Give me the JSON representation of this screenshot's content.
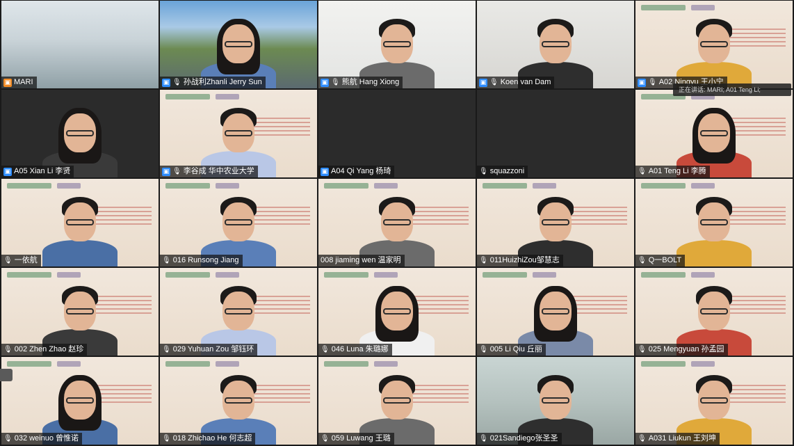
{
  "tiles": [
    {
      "name": "MARI",
      "mic": "none",
      "badge": "orange",
      "bg": "room",
      "person": false
    },
    {
      "name": "孙战利Zhanli Jerry Sun",
      "mic": "mic",
      "badge": "blue",
      "bg": "outdoor",
      "person": true,
      "long_hair": true
    },
    {
      "name": "熊航 Hang Xiong",
      "mic": "mic",
      "badge": "blue",
      "bg": "white",
      "person": true
    },
    {
      "name": "Koen van Dam",
      "mic": "mic",
      "badge": "blue",
      "bg": "wall",
      "person": true
    },
    {
      "name": "A02 Ningyu 王小宁",
      "mic": "mic",
      "badge": "blue",
      "bg": "poster",
      "person": true
    },
    {
      "name": "A05 Xian Li 李贤",
      "mic": "none",
      "badge": "blue",
      "bg": "dark",
      "person": true,
      "long_hair": true
    },
    {
      "name": "李谷成 华中农业大学",
      "mic": "mic",
      "badge": "blue",
      "bg": "poster",
      "person": true
    },
    {
      "name": "A04 Qi Yang 杨琦",
      "mic": "none",
      "badge": "blue",
      "bg": "dark",
      "person": false
    },
    {
      "name": "squazzoni",
      "mic": "mic",
      "badge": "none",
      "bg": "dark",
      "person": false
    },
    {
      "name": "A01 Teng Li 李腾",
      "mic": "mic",
      "badge": "none",
      "bg": "poster",
      "person": true,
      "long_hair": true
    },
    {
      "name": "一依航",
      "mic": "mic",
      "badge": "none",
      "bg": "poster",
      "person": true
    },
    {
      "name": "016 Runsong Jiang",
      "mic": "mic",
      "badge": "none",
      "bg": "poster",
      "person": true
    },
    {
      "name": "008 jiaming wen 温家明",
      "mic": "none",
      "badge": "none",
      "bg": "poster",
      "person": true
    },
    {
      "name": "011HuizhiZou邹慧志",
      "mic": "mic",
      "badge": "none",
      "bg": "poster",
      "person": true
    },
    {
      "name": "Q一BOLT",
      "mic": "mic",
      "badge": "none",
      "bg": "poster",
      "person": true
    },
    {
      "name": "002 Zhen Zhao 赵珍",
      "mic": "mic",
      "badge": "none",
      "bg": "poster",
      "person": true
    },
    {
      "name": "029 Yuhuan Zou 邹钰环",
      "mic": "mic",
      "badge": "none",
      "bg": "poster",
      "person": true
    },
    {
      "name": "046 Luna 朱璐娜",
      "mic": "mic",
      "badge": "none",
      "bg": "poster",
      "person": true,
      "long_hair": true
    },
    {
      "name": "005 Li Qiu 丘丽",
      "mic": "mic",
      "badge": "none",
      "bg": "poster",
      "person": true,
      "long_hair": true
    },
    {
      "name": "025 Mengyuan 孙孟园",
      "mic": "mic",
      "badge": "none",
      "bg": "poster",
      "person": true
    },
    {
      "name": "032 weinuo 曾惟诺",
      "mic": "mic",
      "badge": "none",
      "bg": "poster",
      "person": true,
      "long_hair": true
    },
    {
      "name": "018 Zhichao He 何志超",
      "mic": "mic",
      "badge": "none",
      "bg": "poster",
      "person": true
    },
    {
      "name": "059 Luwang 王璐",
      "mic": "mic",
      "badge": "none",
      "bg": "poster",
      "person": true
    },
    {
      "name": "021Sandiego张圣圣",
      "mic": "mic",
      "badge": "none",
      "bg": "office",
      "person": true
    },
    {
      "name": "A031 Liukun 王刘坤",
      "mic": "mic",
      "badge": "none",
      "bg": "poster",
      "person": true
    }
  ],
  "toast": {
    "text": "正在讲话: MARI; A01 Teng Li;"
  },
  "icons": {
    "mic": "mic-icon",
    "video_badge": "video-badge-icon"
  }
}
